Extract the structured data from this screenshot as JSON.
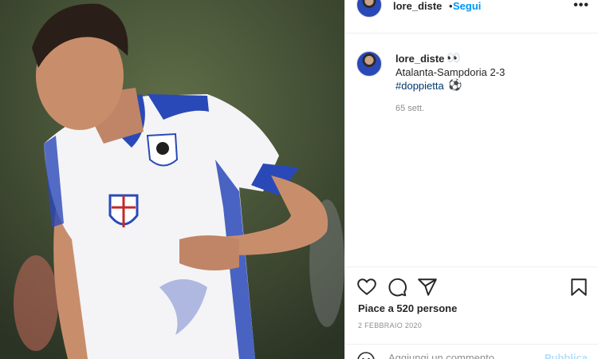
{
  "header": {
    "username": "lore_diste",
    "separator": "•",
    "follow_label": "Segui",
    "more_icon": "more-horizontal-icon"
  },
  "caption": {
    "username": "lore_diste",
    "emoji_eyes": "👀",
    "text": "Atalanta-Sampdoria 2-3",
    "hashtag": "#doppietta",
    "emoji_ball": "⚽",
    "time_ago": "65 sett."
  },
  "actions": {
    "like_icon": "heart-icon",
    "comment_icon": "comment-icon",
    "share_icon": "send-icon",
    "save_icon": "bookmark-icon",
    "likes_text": "Piace a 520 persone",
    "date_text": "2 FEBBRAIO 2020"
  },
  "comment_box": {
    "emoji_icon": "smiley-icon",
    "placeholder": "Aggiungi un commento...",
    "publish_label": "Pubblica"
  },
  "colors": {
    "link_blue": "#0095f6",
    "hashtag": "#00376b",
    "muted": "#8e8e8e",
    "sampdoria_blue": "#2a49b8"
  }
}
